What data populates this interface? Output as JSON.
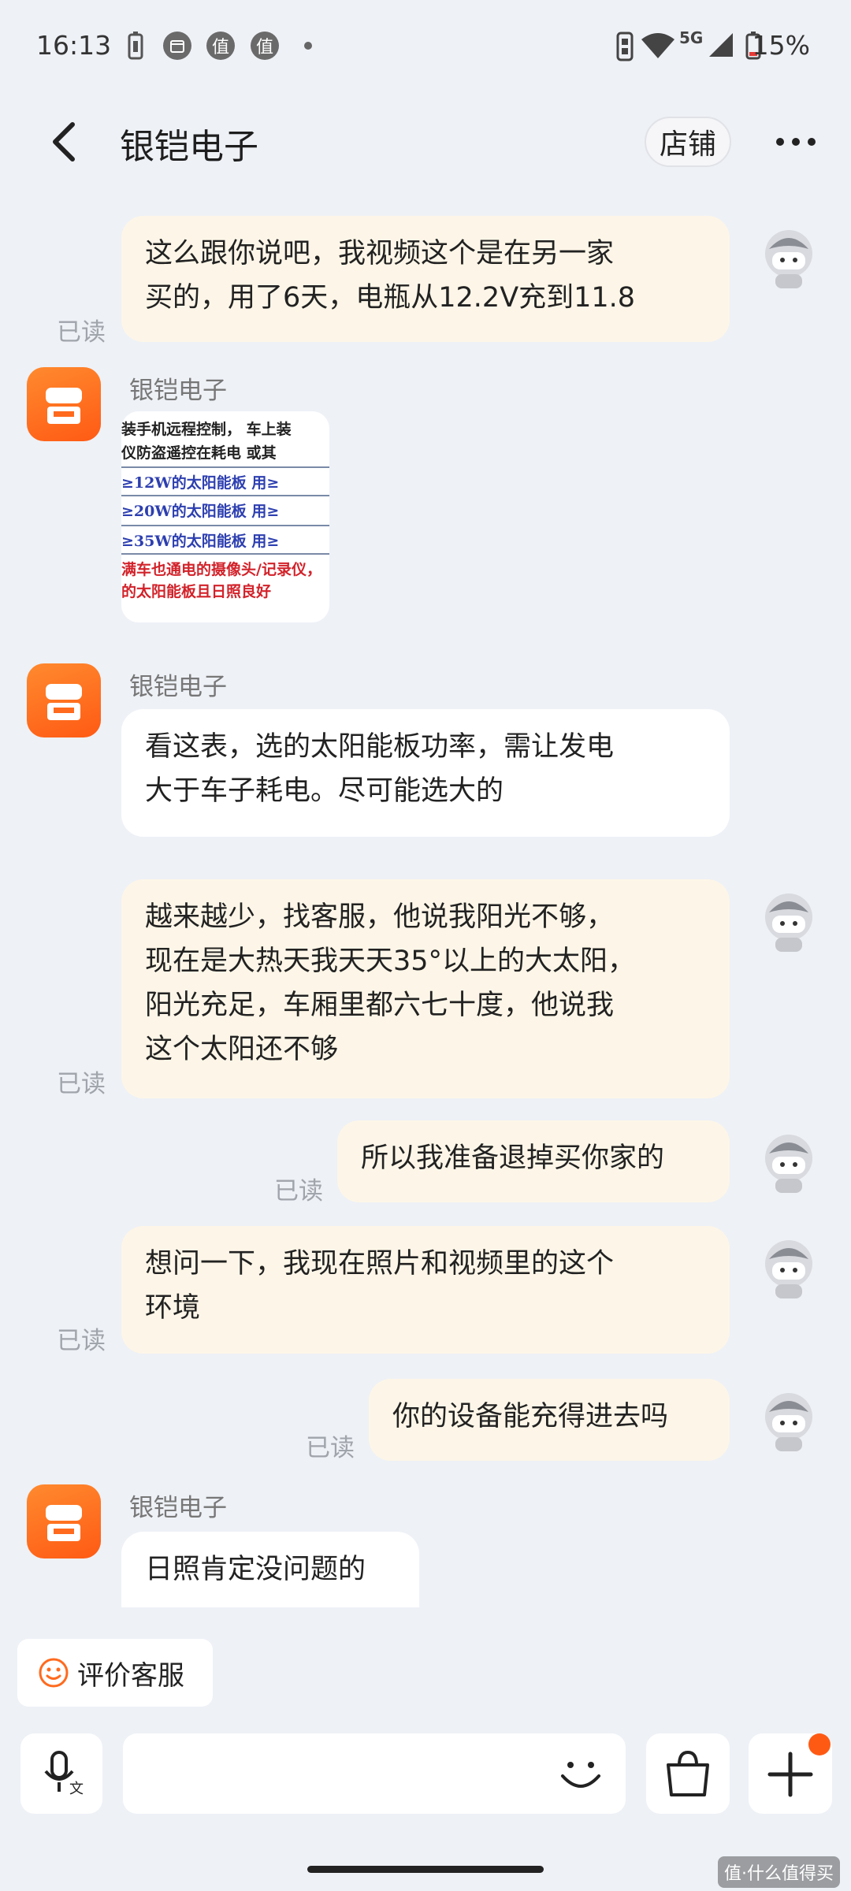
{
  "status_bar": {
    "time": "16:13",
    "icons": [
      "battery-saver-icon",
      "calendar-icon",
      "zhi-app-icon",
      "zhi-app-icon",
      "dot-icon",
      "vibrate-icon",
      "wifi-icon",
      "5g-signal-icon",
      "battery-icon"
    ],
    "badge_char": "值",
    "network_label": "5G",
    "battery_percent": "15%"
  },
  "header": {
    "title": "银铠电子",
    "shop_label": "店铺"
  },
  "read_label": "已读",
  "shop_name": "银铠电子",
  "messages": [
    {
      "from": "me",
      "text_lines": [
        "这么跟你说吧，我视频这个是在另一家",
        "买的，用了6天，电瓶从12.2V充到11.8"
      ]
    },
    {
      "from": "shop",
      "type": "image",
      "table_rows": [
        "装手机远程控制，  车上装",
        "仪防盗遥控在耗电     或其",
        "≥12W的太阳能板      用≥",
        "≥20W的太阳能板      用≥",
        "≥35W的太阳能板      用≥",
        "满车也通电的摄像头/记录仪，",
        "的太阳能板且日照良好"
      ]
    },
    {
      "from": "shop",
      "text_lines": [
        "看这表，选的太阳能板功率，需让发电",
        "大于车子耗电。尽可能选大的"
      ]
    },
    {
      "from": "me",
      "text_lines": [
        "越来越少，找客服，他说我阳光不够，",
        "现在是大热天我天天35°以上的大太阳，",
        "阳光充足，车厢里都六七十度，他说我",
        "这个太阳还不够"
      ]
    },
    {
      "from": "me",
      "text_lines": [
        "所以我准备退掉买你家的"
      ]
    },
    {
      "from": "me",
      "text_lines": [
        "想问一下，我现在照片和视频里的这个",
        "环境"
      ]
    },
    {
      "from": "me",
      "text_lines": [
        "你的设备能充得进去吗"
      ]
    },
    {
      "from": "shop",
      "text_lines": [
        "日照肯定没问题的"
      ]
    }
  ],
  "rate_service_label": "评价客服",
  "bottom_bar": {
    "icons": [
      "voice-to-text-icon",
      "emoji-icon",
      "shopping-bag-icon",
      "plus-icon"
    ]
  },
  "watermark": "值·什么值得买"
}
